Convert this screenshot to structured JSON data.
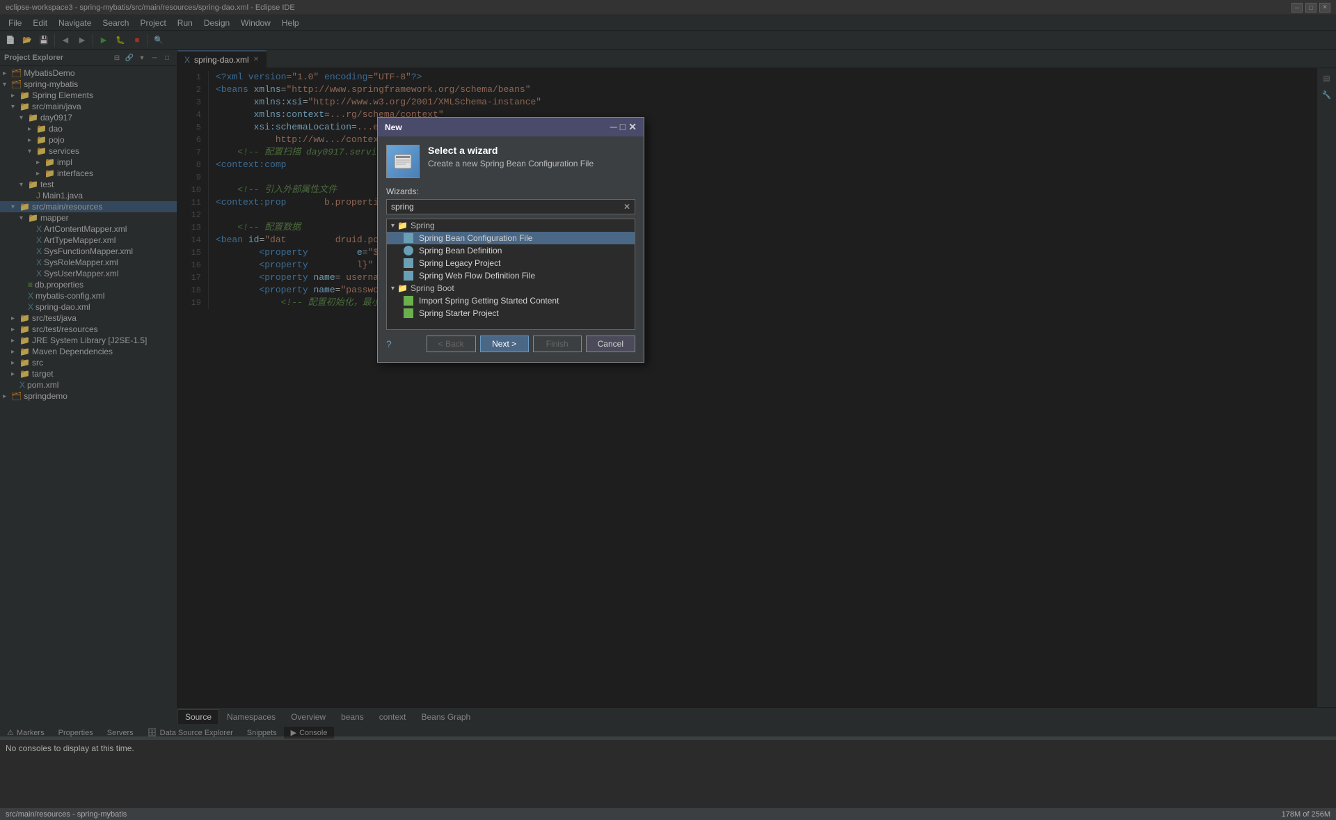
{
  "titleBar": {
    "text": "eclipse-workspace3 - spring-mybatis/src/main/resources/spring-dao.xml - Eclipse IDE",
    "controls": [
      "minimize",
      "maximize",
      "close"
    ]
  },
  "menuBar": {
    "items": [
      "File",
      "Edit",
      "Navigate",
      "Search",
      "Project",
      "Run",
      "Design",
      "Window",
      "Help"
    ]
  },
  "leftPanel": {
    "title": "Project Explorer",
    "tree": [
      {
        "label": "MybatisDemo",
        "indent": 0,
        "type": "project",
        "toggle": "▸"
      },
      {
        "label": "spring-mybatis",
        "indent": 0,
        "type": "project",
        "toggle": "▾"
      },
      {
        "label": "Spring Elements",
        "indent": 1,
        "type": "folder",
        "toggle": "▸"
      },
      {
        "label": "src/main/java",
        "indent": 1,
        "type": "folder",
        "toggle": "▾"
      },
      {
        "label": "day0917",
        "indent": 2,
        "type": "folder",
        "toggle": "▾"
      },
      {
        "label": "dao",
        "indent": 3,
        "type": "folder",
        "toggle": "▸"
      },
      {
        "label": "pojo",
        "indent": 3,
        "type": "folder",
        "toggle": "▸"
      },
      {
        "label": "services",
        "indent": 3,
        "type": "folder",
        "toggle": "▾"
      },
      {
        "label": "impl",
        "indent": 4,
        "type": "folder",
        "toggle": "▸"
      },
      {
        "label": "interfaces",
        "indent": 4,
        "type": "folder",
        "toggle": "▸"
      },
      {
        "label": "test",
        "indent": 2,
        "type": "folder",
        "toggle": "▾"
      },
      {
        "label": "Main1.java",
        "indent": 3,
        "type": "java"
      },
      {
        "label": "src/main/resources",
        "indent": 1,
        "type": "folder",
        "toggle": "▾",
        "selected": true
      },
      {
        "label": "mapper",
        "indent": 2,
        "type": "folder",
        "toggle": "▾"
      },
      {
        "label": "ArtContentMapper.xml",
        "indent": 3,
        "type": "xml"
      },
      {
        "label": "ArtTypeMapper.xml",
        "indent": 3,
        "type": "xml"
      },
      {
        "label": "SysFunctionMapper.xml",
        "indent": 3,
        "type": "xml"
      },
      {
        "label": "SysRoleMapper.xml",
        "indent": 3,
        "type": "xml"
      },
      {
        "label": "SysUserMapper.xml",
        "indent": 3,
        "type": "xml"
      },
      {
        "label": "db.properties",
        "indent": 2,
        "type": "prop"
      },
      {
        "label": "mybatis-config.xml",
        "indent": 2,
        "type": "xml"
      },
      {
        "label": "spring-dao.xml",
        "indent": 2,
        "type": "xml"
      },
      {
        "label": "src/test/java",
        "indent": 1,
        "type": "folder",
        "toggle": "▸"
      },
      {
        "label": "src/test/resources",
        "indent": 1,
        "type": "folder",
        "toggle": "▸"
      },
      {
        "label": "JRE System Library [J2SE-1.5]",
        "indent": 1,
        "type": "folder",
        "toggle": "▸"
      },
      {
        "label": "Maven Dependencies",
        "indent": 1,
        "type": "folder",
        "toggle": "▸"
      },
      {
        "label": "src",
        "indent": 1,
        "type": "folder",
        "toggle": "▸"
      },
      {
        "label": "target",
        "indent": 1,
        "type": "folder",
        "toggle": "▸"
      },
      {
        "label": "pom.xml",
        "indent": 1,
        "type": "xml"
      },
      {
        "label": "springdemo",
        "indent": 0,
        "type": "project",
        "toggle": "▸"
      }
    ]
  },
  "editor": {
    "tabs": [
      {
        "label": "spring-dao.xml",
        "active": true
      }
    ],
    "lines": [
      {
        "num": "1",
        "content": "<?xml version=\"1.0\" encoding=\"UTF-8\"?>"
      },
      {
        "num": "2",
        "content": "<beans xmlns=\"http://www.springframework.org/schema/beans\""
      },
      {
        "num": "3",
        "content": "       xmlns:xsi=\"http://www.w3.org/2001/XMLSchema-instance\""
      },
      {
        "num": "4",
        "content": "       xmlns:context=...rg/schema/context\""
      },
      {
        "num": "5",
        "content": "       xsi:schemaLocation=...ework.org/schema/beans http://www.sp"
      },
      {
        "num": "6",
        "content": "           http://ww.../context http://www.springframework."
      },
      {
        "num": "7",
        "content": "    <!-- 配置扫描 day0917.services\"></context:component-s"
      },
      {
        "num": "8",
        "content": "<context:comp"
      },
      {
        "num": "9",
        "content": ""
      },
      {
        "num": "10",
        "content": "    <!-- 引入外部属性文件"
      },
      {
        "num": "11",
        "content": "<context:prop       b.properties\"/>"
      },
      {
        "num": "12",
        "content": ""
      },
      {
        "num": "13",
        "content": "    <!-- 配置数据"
      },
      {
        "num": "14",
        "content": "<bean id=\"dat         druid.pool.DruidDataSource\">"
      },
      {
        "num": "15",
        "content": "        <property         e=\"${jdbc.driver}\" />"
      },
      {
        "num": "16",
        "content": "        <property         l}\" />"
      },
      {
        "num": "17",
        "content": "        <property name= username  value= ${jdbc.username}\" />"
      },
      {
        "num": "18",
        "content": "        <property name=\"password\" value=\"${jdbc.password}\" />"
      },
      {
        "num": "19",
        "content": "            <!-- 配置初始化，最小，最大 -->"
      }
    ],
    "bottomTabs": [
      "Source",
      "Namespaces",
      "Overview",
      "beans",
      "context",
      "Beans Graph"
    ]
  },
  "dialog": {
    "title": "New",
    "selectWizardTitle": "Select a wizard",
    "selectWizardDesc": "Create a new Spring Bean Configuration File",
    "wizardsLabel": "Wizards:",
    "searchPlaceholder": "spring",
    "treeItems": [
      {
        "type": "group",
        "label": "Spring",
        "toggle": "▾",
        "indent": 0
      },
      {
        "type": "item",
        "label": "Spring Bean Configuration File",
        "indent": 1,
        "selected": true
      },
      {
        "type": "item",
        "label": "Spring Bean Definition",
        "indent": 1
      },
      {
        "type": "item",
        "label": "Spring Legacy Project",
        "indent": 1
      },
      {
        "type": "item",
        "label": "Spring Web Flow Definition File",
        "indent": 1
      },
      {
        "type": "group",
        "label": "Spring Boot",
        "toggle": "▾",
        "indent": 0
      },
      {
        "type": "item",
        "label": "Import Spring Getting Started Content",
        "indent": 1
      },
      {
        "type": "item",
        "label": "Spring Starter Project",
        "indent": 1
      }
    ],
    "buttons": {
      "back": "< Back",
      "next": "Next >",
      "finish": "Finish",
      "cancel": "Cancel"
    }
  },
  "bottomPanel": {
    "tabs": [
      "Markers",
      "Properties",
      "Servers",
      "Data Source Explorer",
      "Snippets",
      "Console"
    ],
    "activeTab": "Console",
    "content": "No consoles to display at this time."
  },
  "statusBar": {
    "left": "src/main/resources - spring-mybatis",
    "right": "178M of 256M"
  }
}
